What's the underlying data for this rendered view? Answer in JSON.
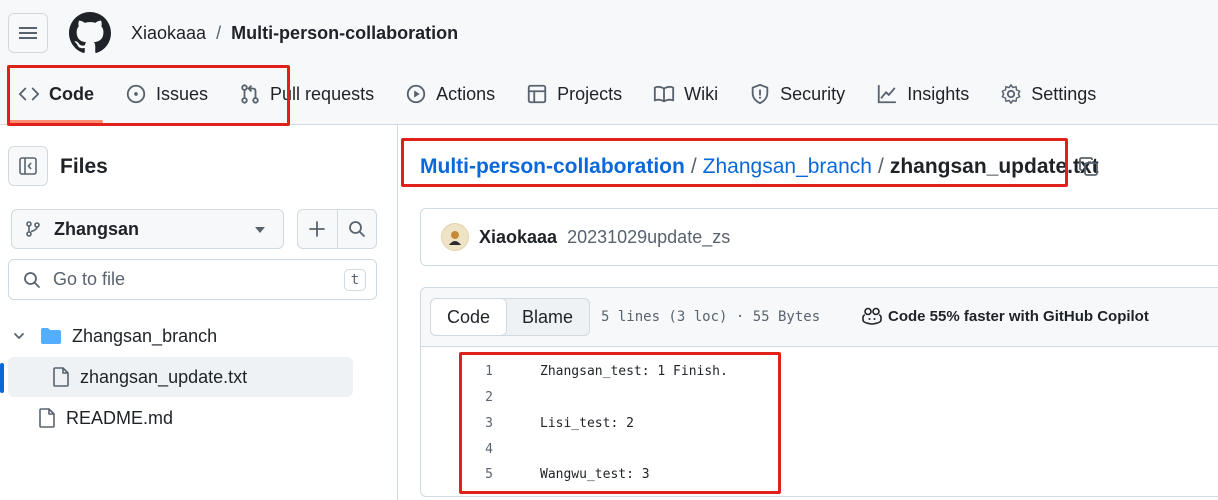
{
  "header": {
    "owner": "Xiaokaaa",
    "separator": "/",
    "repo": "Multi-person-collaboration"
  },
  "nav": [
    {
      "label": "Code",
      "icon": "code-icon",
      "active": true
    },
    {
      "label": "Issues",
      "icon": "issue-icon"
    },
    {
      "label": "Pull requests",
      "icon": "pull-request-icon"
    },
    {
      "label": "Actions",
      "icon": "play-icon"
    },
    {
      "label": "Projects",
      "icon": "table-icon"
    },
    {
      "label": "Wiki",
      "icon": "book-icon"
    },
    {
      "label": "Security",
      "icon": "shield-icon"
    },
    {
      "label": "Insights",
      "icon": "graph-icon"
    },
    {
      "label": "Settings",
      "icon": "gear-icon"
    }
  ],
  "sidebar": {
    "title": "Files",
    "branch": "Zhangsan",
    "search_placeholder": "Go to file",
    "search_shortcut": "t",
    "tree": [
      {
        "name": "Zhangsan_branch",
        "type": "folder"
      },
      {
        "name": "zhangsan_update.txt",
        "type": "file",
        "selected": true
      },
      {
        "name": "README.md",
        "type": "file"
      }
    ]
  },
  "breadcrumbs": {
    "repo": "Multi-person-collaboration",
    "folder": "Zhangsan_branch",
    "separator": "/",
    "file": "zhangsan_update.txt"
  },
  "commit": {
    "author": "Xiaokaaa",
    "message": "20231029update_zs"
  },
  "file_view": {
    "tabs": [
      "Code",
      "Blame"
    ],
    "active_tab": "Code",
    "meta": "5 lines (3 loc) · 55 Bytes",
    "copilot": "Code 55% faster with GitHub Copilot",
    "lines": [
      {
        "n": "1",
        "text": "Zhangsan_test: 1 Finish."
      },
      {
        "n": "2",
        "text": ""
      },
      {
        "n": "3",
        "text": "Lisi_test: 2"
      },
      {
        "n": "4",
        "text": ""
      },
      {
        "n": "5",
        "text": "Wangwu_test: 3"
      }
    ]
  },
  "colors": {
    "accent": "#0969da",
    "highlight_box": "#e0201b",
    "active_tab_underline": "#fd8c73"
  }
}
